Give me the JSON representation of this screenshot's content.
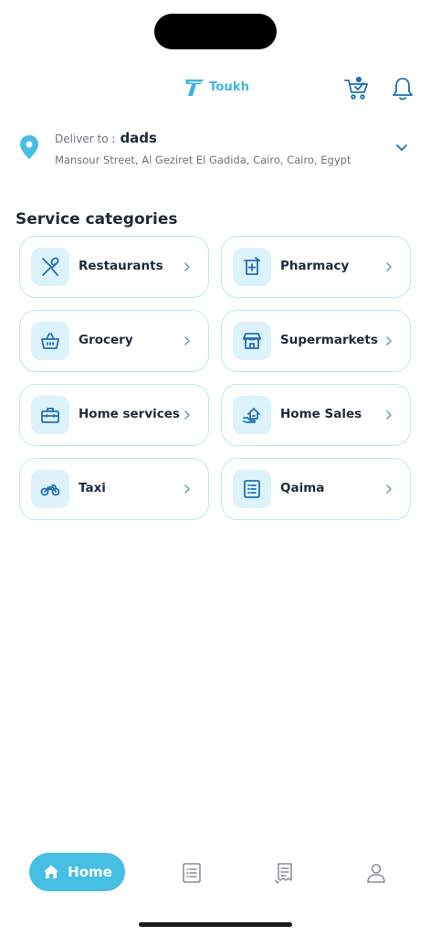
{
  "app": {
    "brand": "Toukh"
  },
  "colors": {
    "accent": "#45bfe4",
    "icon_blue": "#1e6fb5",
    "card_border": "#bfe6f4",
    "icon_bg": "#ddf3fb"
  },
  "header": {
    "cart_icon": "cart-icon",
    "notification_icon": "bell-icon"
  },
  "delivery": {
    "label": "Deliver to :",
    "name": "dads",
    "address": "Mansour Street, Al Geziret El Gadida, Cairo, Cairo, Egypt"
  },
  "section": {
    "title": "Service categories"
  },
  "categories": [
    {
      "label": "Restaurants",
      "icon": "fork-spoon-icon"
    },
    {
      "label": "Pharmacy",
      "icon": "pharmacy-icon"
    },
    {
      "label": "Grocery",
      "icon": "basket-icon"
    },
    {
      "label": "Supermarkets",
      "icon": "store-icon"
    },
    {
      "label": "Home services",
      "icon": "toolbox-icon"
    },
    {
      "label": "Home Sales",
      "icon": "house-hand-icon"
    },
    {
      "label": "Taxi",
      "icon": "motorbike-icon"
    },
    {
      "label": "Qaima",
      "icon": "list-icon"
    }
  ],
  "nav": {
    "home_label": "Home",
    "items": [
      "home-icon",
      "orders-list-icon",
      "receipt-icon",
      "profile-icon"
    ]
  }
}
